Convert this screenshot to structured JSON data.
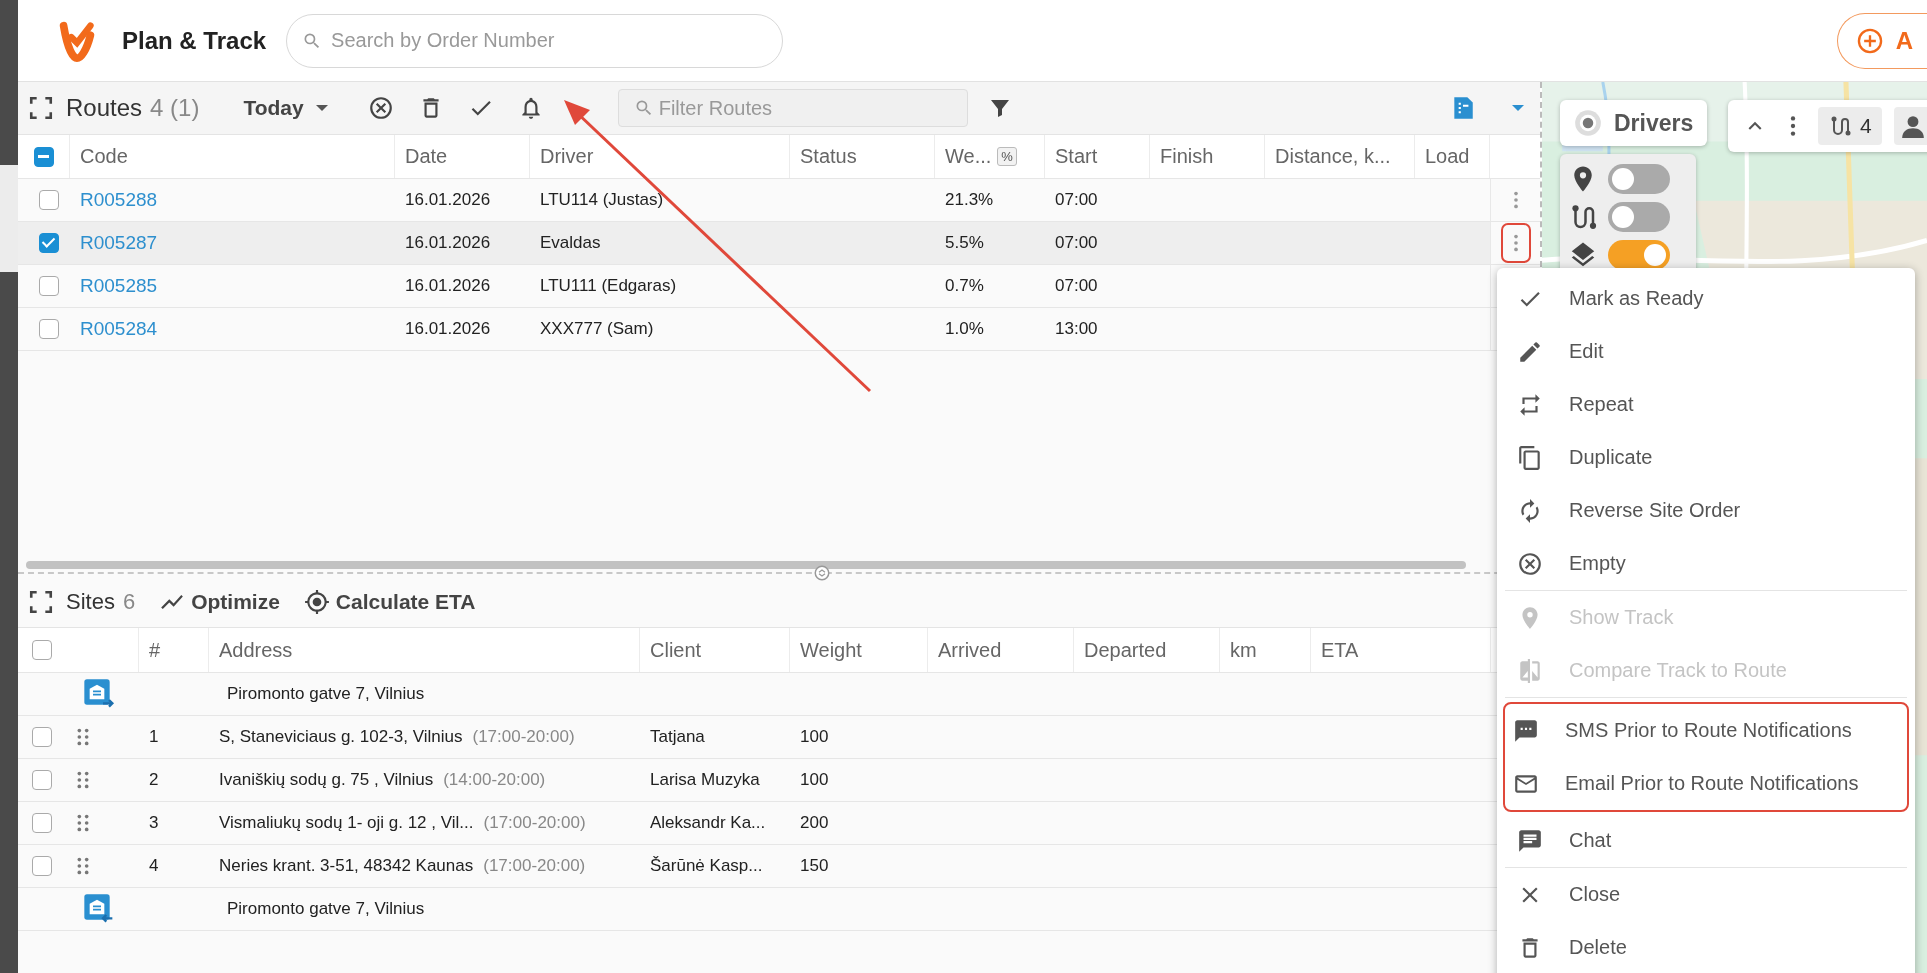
{
  "header": {
    "title": "Plan & Track",
    "search": {
      "placeholder": "Search by Order Number"
    },
    "action_button": {
      "label": "A"
    }
  },
  "routes": {
    "title": "Routes",
    "count": "4 (1)",
    "period": "Today",
    "filter": {
      "placeholder": "Filter Routes"
    },
    "table": {
      "header_checkbox": {
        "indeterminate": true
      },
      "columns": [
        {
          "label": "Code"
        },
        {
          "label": "Date"
        },
        {
          "label": "Driver"
        },
        {
          "label": "Status"
        },
        {
          "label": "We...",
          "badge": "%"
        },
        {
          "label": "Start"
        },
        {
          "label": "Finish"
        },
        {
          "label": "Distance, k..."
        },
        {
          "label": "Load"
        }
      ],
      "rows": [
        {
          "selected": false,
          "menu_open": false,
          "code": "R005288",
          "date": "16.01.2026",
          "driver": "LTU114 (Justas)",
          "weight": "21.3%",
          "start": "07:00"
        },
        {
          "selected": true,
          "menu_open": true,
          "code": "R005287",
          "date": "16.01.2026",
          "driver": "Evaldas",
          "weight": "5.5%",
          "start": "07:00"
        },
        {
          "selected": false,
          "code": "R005285",
          "date": "16.01.2026",
          "driver": "LTU111 (Edgaras)",
          "weight": "0.7%",
          "start": "07:00"
        },
        {
          "selected": false,
          "code": "R005284",
          "date": "16.01.2026",
          "driver": "XXX777 (Sam)",
          "weight": "1.0%",
          "start": "13:00"
        }
      ]
    }
  },
  "sites": {
    "title": "Sites",
    "count": "6",
    "actions": [
      {
        "label": "Optimize"
      },
      {
        "label": "Calculate ETA"
      }
    ],
    "table": {
      "header_checkbox": {
        "indeterminate": false
      },
      "columns": [
        {
          "label": "#"
        },
        {
          "label": "Address"
        },
        {
          "label": "Client"
        },
        {
          "label": "Weight"
        },
        {
          "label": "Arrived"
        },
        {
          "label": "Departed"
        },
        {
          "label": "km"
        },
        {
          "label": "ETA"
        }
      ],
      "rows": [
        {
          "kind": "depot_start",
          "address": "Piromonto gatve 7, Vilnius"
        },
        {
          "kind": "stop",
          "checked": false,
          "number": "1",
          "address": "S, Staneviciaus g. 102-3, Vilnius",
          "window": "(17:00-20:00)",
          "client": "Tatjana",
          "weight": "100"
        },
        {
          "kind": "stop",
          "checked": false,
          "number": "2",
          "address": "Ivaniškių sodų g. 75 , Vilnius",
          "window": "(14:00-20:00)",
          "client": "Larisa Muzyka",
          "weight": "100"
        },
        {
          "kind": "stop",
          "checked": false,
          "number": "3",
          "address": "Vismaliukų sodų 1- oji g. 12 , Vil...",
          "window": "(17:00-20:00)",
          "client": "Aleksandr Ka...",
          "weight": "200"
        },
        {
          "kind": "stop",
          "checked": false,
          "number": "4",
          "address": "Neries krant. 3-51, 48342 Kaunas",
          "window": "(17:00-20:00)",
          "client": "Šarūnė Kasp...",
          "weight": "150"
        },
        {
          "kind": "depot_end",
          "address": "Piromonto gatve 7, Vilnius"
        }
      ]
    }
  },
  "map": {
    "drivers_button": "Drivers",
    "routes_count": "4",
    "layers": [
      {
        "on": false
      },
      {
        "on": false
      },
      {
        "on": true
      }
    ]
  },
  "menu": {
    "groups": [
      {
        "highlighted": false,
        "items": [
          {
            "label": "Mark as Ready",
            "disabled": false
          },
          {
            "label": "Edit",
            "disabled": false
          },
          {
            "label": "Repeat",
            "disabled": false
          },
          {
            "label": "Duplicate",
            "disabled": false
          },
          {
            "label": "Reverse Site Order",
            "disabled": false
          },
          {
            "label": "Empty",
            "disabled": false
          }
        ]
      },
      {
        "highlighted": false,
        "items": [
          {
            "label": "Show Track",
            "disabled": true
          },
          {
            "label": "Compare Track to Route",
            "disabled": true
          }
        ]
      },
      {
        "highlighted": true,
        "items": [
          {
            "label": "SMS Prior to Route Notifications",
            "disabled": false
          },
          {
            "label": "Email Prior to Route Notifications",
            "disabled": false
          }
        ]
      },
      {
        "highlighted": false,
        "items": [
          {
            "label": "Chat",
            "disabled": false
          }
        ]
      },
      {
        "highlighted": false,
        "items": [
          {
            "label": "Close",
            "disabled": false
          },
          {
            "label": "Delete",
            "disabled": false
          }
        ]
      }
    ]
  }
}
